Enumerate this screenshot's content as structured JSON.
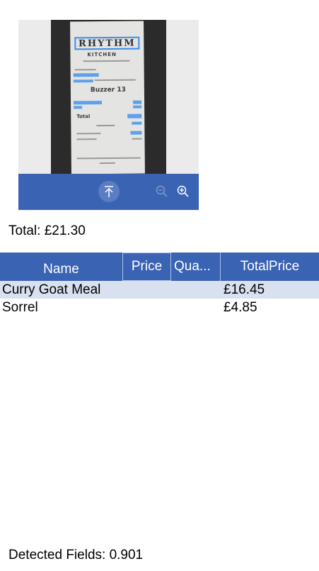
{
  "receipt_image": {
    "brand": "RHYTHM",
    "sub": "KITCHEN",
    "buzzer": "Buzzer 13",
    "total_word": "Total"
  },
  "toolbar": {
    "upload_icon": "upload-icon",
    "zoom_out_icon": "zoom-out-icon",
    "zoom_in_icon": "zoom-in-icon"
  },
  "total": {
    "label": "Total: £21.30"
  },
  "table": {
    "headers": {
      "name": "Name",
      "price": "Price",
      "quantity": "Qua...",
      "total_price": "TotalPrice"
    },
    "rows": [
      {
        "name": "Curry Goat Meal",
        "price": "",
        "quantity": "",
        "total_price": "£16.45"
      },
      {
        "name": "Sorrel",
        "price": "",
        "quantity": "",
        "total_price": "£4.85"
      }
    ]
  },
  "detected": {
    "label": "Detected Fields: 0.901"
  },
  "colors": {
    "accent": "#3b63b3",
    "row_alt": "#d9e0f0",
    "highlight": "#4f98ec"
  }
}
